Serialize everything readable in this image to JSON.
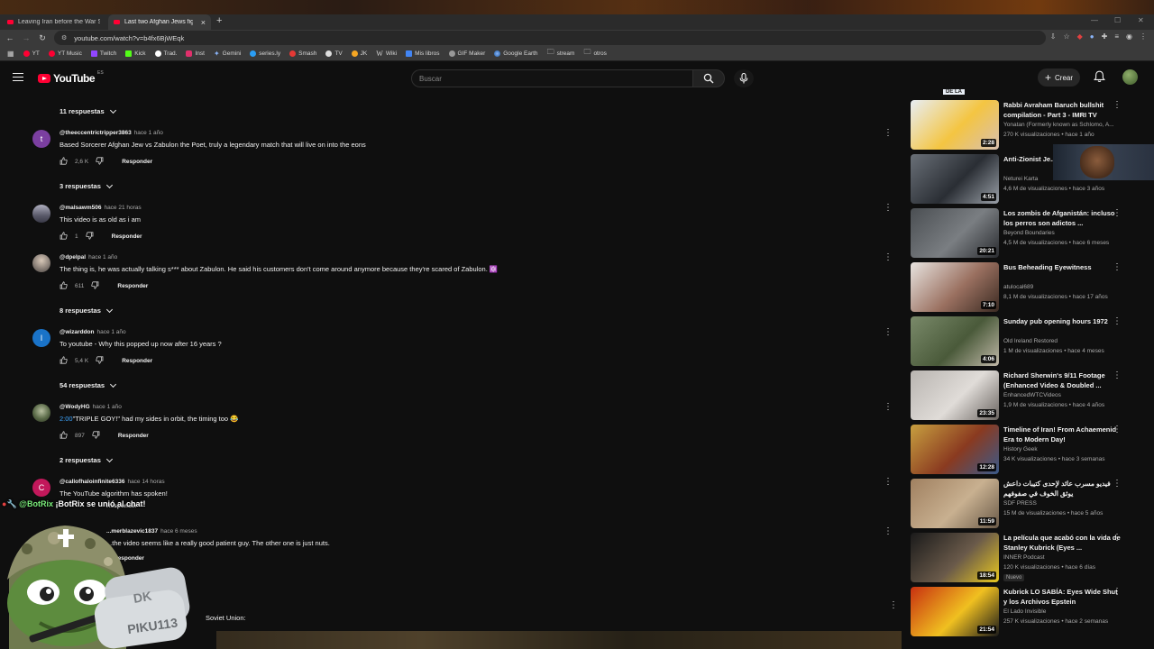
{
  "browser": {
    "tabs": [
      {
        "title": "Leaving Iran before the War S...",
        "active": false
      },
      {
        "title": "Last two Afghan Jews fight",
        "active": true
      }
    ],
    "url": "youtube.com/watch?v=b4fx6BjWEqk",
    "bookmarks": [
      {
        "label": "YT",
        "color": "#ff0033"
      },
      {
        "label": "YT Music",
        "color": "#ff0033"
      },
      {
        "label": "Twitch",
        "color": "#9146ff"
      },
      {
        "label": "Kick",
        "color": "#53fc18"
      },
      {
        "label": "Trad.",
        "color": "#4285f4"
      },
      {
        "label": "Inst",
        "color": "#e1306c"
      },
      {
        "label": "Gemini",
        "color": "#8ab4f8"
      },
      {
        "label": "series.ly",
        "color": "#2a9df4"
      },
      {
        "label": "Smash",
        "color": "#e53935"
      },
      {
        "label": "TV",
        "color": "#dddddd"
      },
      {
        "label": "JK",
        "color": "#f5a623"
      },
      {
        "label": "Wiki",
        "color": "#ffffff"
      },
      {
        "label": "Mis libros",
        "color": "#4285f4"
      },
      {
        "label": "GIF Maker",
        "color": "#999999"
      },
      {
        "label": "Google Earth",
        "color": "#4285f4"
      },
      {
        "label": "stream",
        "color": "#bbbbbb"
      },
      {
        "label": "otros",
        "color": "#bbbbbb"
      }
    ]
  },
  "header": {
    "logo": "YouTube",
    "region": "ES",
    "search_placeholder": "Buscar",
    "create_label": "Crear"
  },
  "comments": {
    "reply_label": "Responder",
    "toggles": [
      {
        "label": "11 respuestas"
      },
      {
        "label": "3 respuestas"
      },
      {
        "label": "8 respuestas"
      },
      {
        "label": "54 respuestas"
      },
      {
        "label": "2 respuestas"
      }
    ],
    "items": [
      {
        "handle": "@theeccentrictripper3863",
        "time": "hace 1 año",
        "text": "Based Sorcerer Afghan Jew vs Zabulon the Poet, truly a legendary match that will live on into the eons",
        "likes": "2,6 K",
        "avatar_letter": "t",
        "avatar_color": "#7b3fa0"
      },
      {
        "handle": "@malsawm506",
        "time": "hace 21 horas",
        "text": "This video is as old as i am",
        "likes": "1",
        "avatar_letter": "",
        "avatar_color": "#6a6a7a"
      },
      {
        "handle": "@dpelpal",
        "time": "hace 1 año",
        "text": "The thing is, he was actually talking s*** about Zabulon. He said his customers don't come around anymore because they're scared of Zabulon. 🔯",
        "likes": "611",
        "avatar_letter": "",
        "avatar_color": "#8a8078"
      },
      {
        "handle": "@wizarddon",
        "time": "hace 1 año",
        "text": "To youtube - Why this popped up now after 16 years ?",
        "likes": "5,4 K",
        "avatar_letter": "I",
        "avatar_color": "#1a73c8"
      },
      {
        "handle": "@WodyHG",
        "time": "hace 1 año",
        "timestamp": "2:00",
        "text": "\"TRIPLE GOY!\" had my sides in orbit, the timing too 😂",
        "likes": "897",
        "avatar_letter": "",
        "avatar_color": "#5a6a48"
      },
      {
        "handle": "@callofhaloinfinite6336",
        "time": "hace 14 horas",
        "text": "The YouTube algorithm has spoken!",
        "likes": "",
        "avatar_letter": "C",
        "avatar_color": "#c2185b"
      },
      {
        "handle": "...merblazevic1837",
        "time": "hace 6 meses",
        "text": "...the video seems like a really good patient guy. The other one is just nuts.",
        "likes": "",
        "avatar_letter": "",
        "avatar_color": "#333333"
      }
    ],
    "partial_bottom_text": "Soviet Union:"
  },
  "sidebar": {
    "partial_top_label": "DE LA",
    "items": [
      {
        "title": "Rabbi Avraham Baruch bullshit compilation - Part 3 - IMRI TV",
        "channel": "Yonatan (Formerly known as Schlomo, A...",
        "views": "270 K visualizaciones",
        "age": "hace 1 año",
        "duration": "2:28",
        "thumb": [
          "#e8eef5",
          "#f4c542",
          "#d8c0b0"
        ]
      },
      {
        "title": "Anti-Zionist Je... flying Palestin...",
        "channel": "Neturei Karta",
        "views": "4,6 M de visualizaciones",
        "age": "hace 3 años",
        "duration": "4:51",
        "thumb": [
          "#6a7078",
          "#2a2e34",
          "#9aa0a8"
        ]
      },
      {
        "title": "Los zombis de Afganistán: incluso los perros son adictos ...",
        "channel": "Beyond Boundaries",
        "views": "4,5 M de visualizaciones",
        "age": "hace 6 meses",
        "duration": "20:21",
        "thumb": [
          "#4a4e52",
          "#7a7e82",
          "#2a2c30"
        ]
      },
      {
        "title": "Bus Beheading Eyewitness",
        "channel": "atulocal689",
        "views": "8,1 M de visualizaciones",
        "age": "hace 17 años",
        "duration": "7:10",
        "thumb": [
          "#e8e4e0",
          "#9a7060",
          "#3a2a22"
        ]
      },
      {
        "title": "Sunday pub opening hours 1972",
        "channel": "Old Ireland Restored",
        "views": "1 M de visualizaciones",
        "age": "hace 4 meses",
        "duration": "4:06",
        "thumb": [
          "#7a8a6a",
          "#4a5a3a",
          "#c0b8a8"
        ]
      },
      {
        "title": "Richard Sherwin's 9/11 Footage (Enhanced Video & Doubled ...",
        "channel": "EnhancedWTCVideos",
        "views": "1,9 M de visualizaciones",
        "age": "hace 4 años",
        "duration": "23:35",
        "thumb": [
          "#b8b4b0",
          "#e0dcd8",
          "#6a6460"
        ]
      },
      {
        "title": "Timeline of Iran! From Achaemenid Era to Modern Day!",
        "channel": "History Geek",
        "views": "34 K visualizaciones",
        "age": "hace 3 semanas",
        "duration": "12:28",
        "thumb": [
          "#c8a040",
          "#8a3a20",
          "#3a5a8a"
        ]
      },
      {
        "title": "فيديو مسرب عائد لإحدى كتيبات داعش يوثق الخوف في صفوفهم",
        "channel": "SDF PRESS",
        "views": "15 M de visualizaciones",
        "age": "hace 5 años",
        "duration": "11:59",
        "thumb": [
          "#a08060",
          "#c8b090",
          "#6a5a48"
        ]
      },
      {
        "title": "La película que acabó con la vida de Stanley Kubrick (Eyes ...",
        "channel": "INNER Podcast",
        "views": "120 K visualizaciones",
        "age": "hace 6 días",
        "duration": "18:54",
        "badge": "Nuevo",
        "thumb": [
          "#1a1a1a",
          "#6a5a4a",
          "#e8c820"
        ]
      },
      {
        "title": "Kubrick LO SABÍA: Eyes Wide Shut y los Archivos Epstein",
        "channel": "El Lado Invisible",
        "views": "257 K visualizaciones",
        "age": "hace 2 semanas",
        "duration": "21:54",
        "thumb": [
          "#c83010",
          "#f0c020",
          "#1a1a1a"
        ]
      }
    ]
  },
  "overlays": {
    "chat_user": "@BotRix",
    "chat_message": "¡BotRix se unió al chat!",
    "sticker_text": "PIKU113",
    "sticker_brand": "DK"
  }
}
